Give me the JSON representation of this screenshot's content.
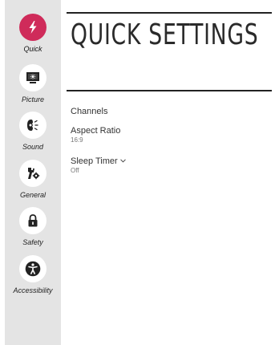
{
  "page": {
    "title": "QUICK SETTINGS"
  },
  "sidebar": {
    "items": [
      {
        "label": "Quick",
        "icon": "lightning-icon",
        "active": true
      },
      {
        "label": "Picture",
        "icon": "picture-icon",
        "active": false
      },
      {
        "label": "Sound",
        "icon": "sound-icon",
        "active": false
      },
      {
        "label": "General",
        "icon": "general-icon",
        "active": false
      },
      {
        "label": "Safety",
        "icon": "lock-icon",
        "active": false
      },
      {
        "label": "Accessibility",
        "icon": "accessibility-icon",
        "active": false
      }
    ]
  },
  "settings": {
    "channels": {
      "label": "Channels"
    },
    "aspect_ratio": {
      "label": "Aspect Ratio",
      "value": "16:9"
    },
    "sleep_timer": {
      "label": "Sleep Timer",
      "value": "Off",
      "chevron": "chevron-down-icon"
    }
  },
  "colors": {
    "accent": "#cf2b5a",
    "sidebar_bg": "#e4e4e4"
  }
}
